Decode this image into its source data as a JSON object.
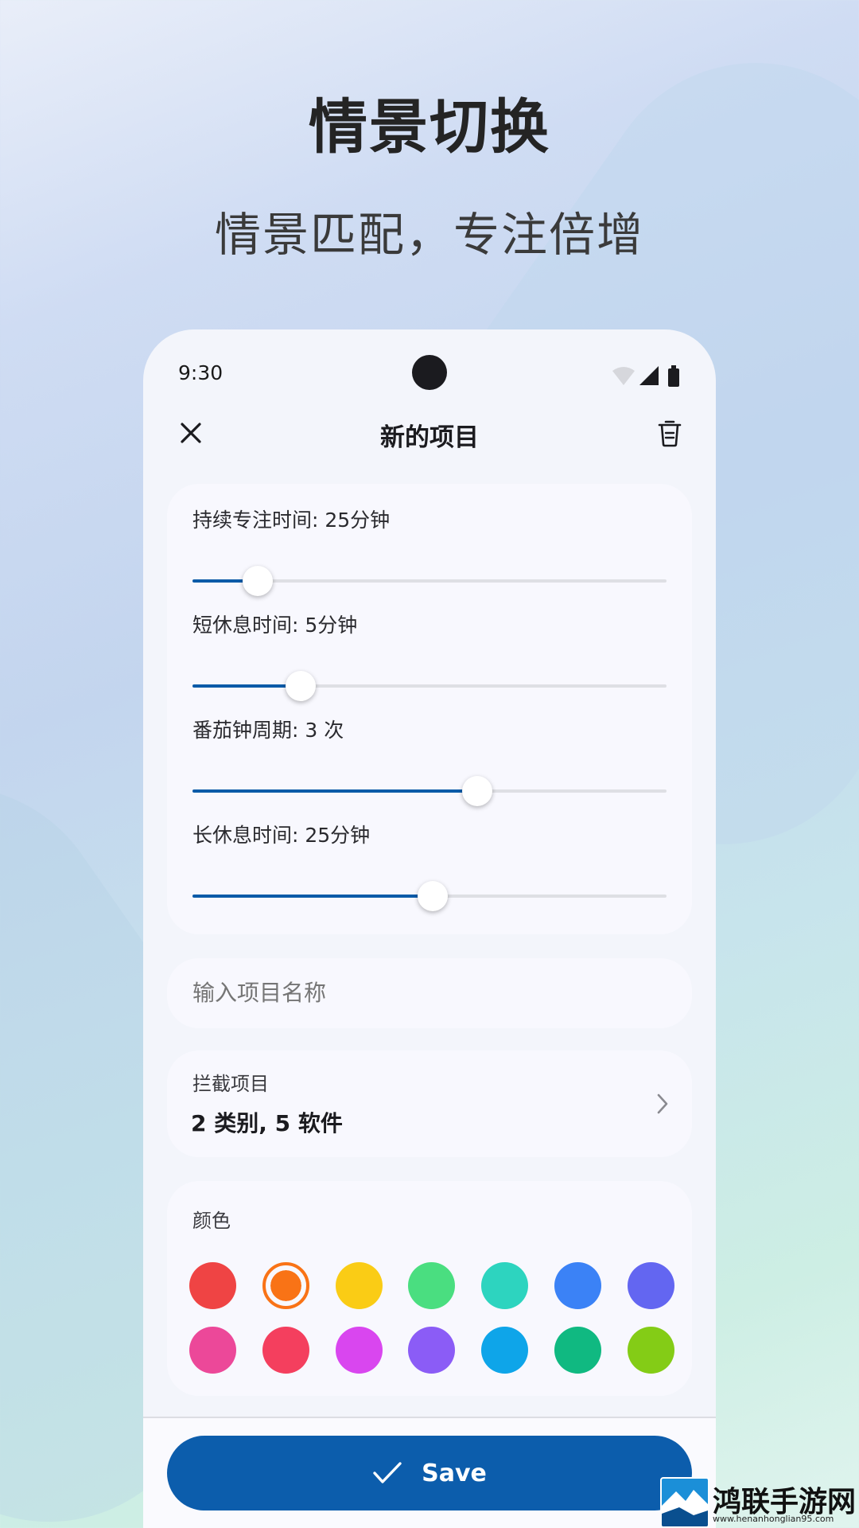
{
  "promo": {
    "headline": "情景切换",
    "subheadline": "情景匹配，专注倍增"
  },
  "status_bar": {
    "time": "9:30",
    "icons": [
      "wifi-icon",
      "signal-icon",
      "battery-icon"
    ]
  },
  "app_bar": {
    "title": "新的项目",
    "close_icon": "close-icon",
    "delete_icon": "trash-icon"
  },
  "sliders": [
    {
      "label": "持续专注时间: 25分钟",
      "fraction": 0.137
    },
    {
      "label": "短休息时间: 5分钟",
      "fraction": 0.229
    },
    {
      "label": "番茄钟周期: 3 次",
      "fraction": 0.6
    },
    {
      "label": "长休息时间: 25分钟",
      "fraction": 0.507
    }
  ],
  "name_input": {
    "placeholder": "输入项目名称",
    "value": ""
  },
  "blocked_items": {
    "title": "拦截项目",
    "value": "2 类别, 5 软件"
  },
  "colors": {
    "title": "颜色",
    "selected_index": 1,
    "swatches": [
      "#ef4444",
      "#f97316",
      "#facc15",
      "#4ade80",
      "#2dd4bf",
      "#3b82f6",
      "#6366f1",
      "#ec4899",
      "#f43f5e",
      "#d946ef",
      "#8b5cf6",
      "#0ea5e9",
      "#10b981",
      "#84cc16"
    ]
  },
  "save_button": {
    "label": "Save",
    "accent": "#0c5dac"
  },
  "watermark": {
    "name": "鸿联手游网",
    "url": "www.henanhonglian95.com"
  }
}
